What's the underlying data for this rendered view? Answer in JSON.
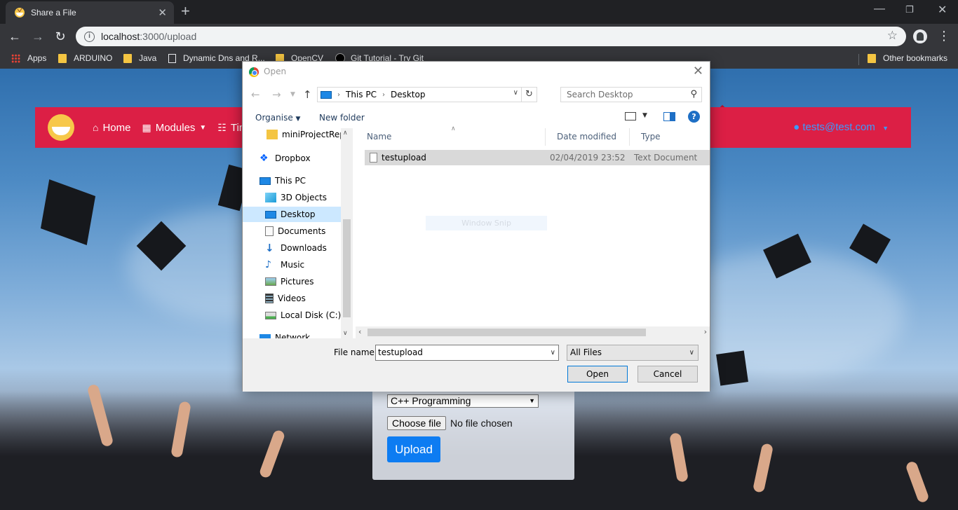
{
  "browser": {
    "tab_title": "Share a File",
    "tab_close": "✕",
    "new_tab": "+",
    "url_host": "localhost",
    "url_path": ":3000/upload",
    "bookmarks": [
      "Apps",
      "ARDUINO",
      "Java",
      "Dynamic Dns and R...",
      "OpenCV",
      "Git Tutorial - Try Git"
    ],
    "other_bookmarks": "Other bookmarks"
  },
  "app": {
    "nav": {
      "home": "Home",
      "modules": "Modules",
      "timetable": "Tim",
      "user": "tests@test.com"
    },
    "form": {
      "module_selected": "C++ Programming",
      "choose_file": "Choose file",
      "no_file": "No file chosen",
      "upload": "Upload"
    }
  },
  "dialog": {
    "title": "Open",
    "breadcrumb": [
      "This PC",
      "Desktop"
    ],
    "search_placeholder": "Search Desktop",
    "organise": "Organise",
    "new_folder": "New folder",
    "nav_items": [
      {
        "label": "miniProjectRepo",
        "icon": "folder-icon"
      },
      {
        "label": "Dropbox",
        "icon": "dropbox-icon"
      },
      {
        "label": "This PC",
        "icon": "computer-icon"
      },
      {
        "label": "3D Objects",
        "icon": "3d-objects-icon"
      },
      {
        "label": "Desktop",
        "icon": "desktop-icon"
      },
      {
        "label": "Documents",
        "icon": "documents-icon"
      },
      {
        "label": "Downloads",
        "icon": "downloads-icon"
      },
      {
        "label": "Music",
        "icon": "music-icon"
      },
      {
        "label": "Pictures",
        "icon": "pictures-icon"
      },
      {
        "label": "Videos",
        "icon": "videos-icon"
      },
      {
        "label": "Local Disk (C:)",
        "icon": "disk-icon"
      },
      {
        "label": "Network",
        "icon": "network-icon"
      }
    ],
    "columns": [
      "Name",
      "Date modified",
      "Type"
    ],
    "files": [
      {
        "name": "testupload",
        "modified": "02/04/2019 23:52",
        "type": "Text Document"
      }
    ],
    "ghost_label": "Window Snip",
    "file_name_label": "File name:",
    "file_name_value": "testupload",
    "file_type": "All Files",
    "open_button": "Open",
    "cancel_button": "Cancel"
  },
  "colors": {
    "nav_red": "#dc1f45",
    "upload_blue": "#0d7cf2",
    "user_link": "#3b9bff"
  }
}
